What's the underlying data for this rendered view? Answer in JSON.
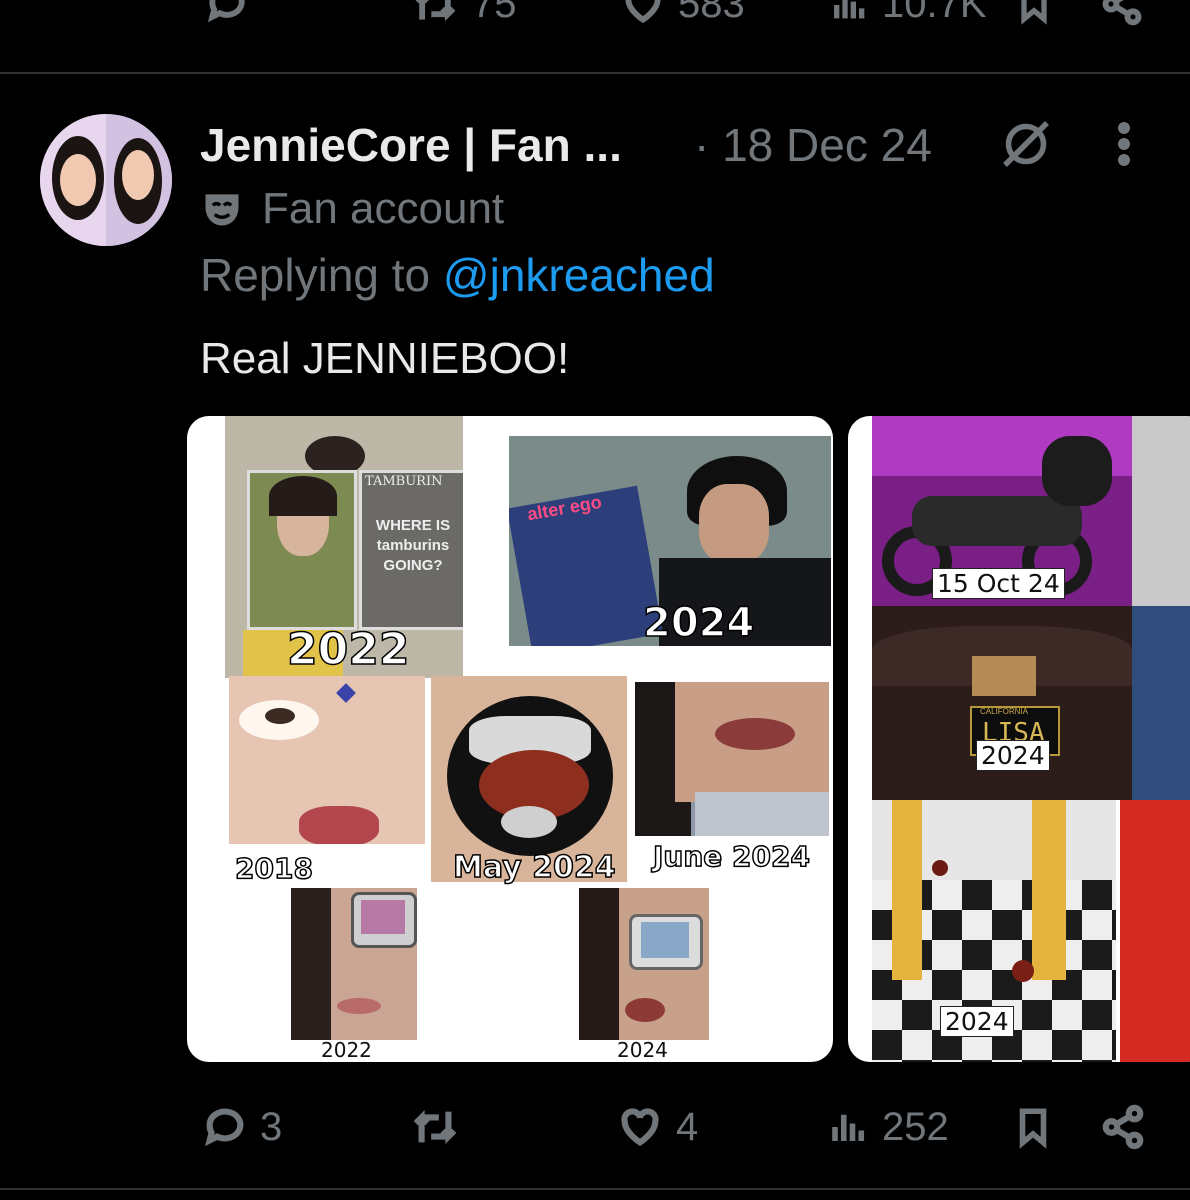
{
  "previous_post": {
    "retweets": "75",
    "likes": "583",
    "views": "10.7K"
  },
  "post": {
    "display_name": "JennieCore | Fan ...",
    "date": "· 18 Dec 24",
    "account_label": "Fan account",
    "reply_prefix": "Replying to",
    "reply_handle": "@jnkreached",
    "text": "Real JENNIEBOO!",
    "replies": "3",
    "retweets": "",
    "likes": "4",
    "views": "252"
  },
  "media_1": {
    "magazine_title": "TAMBURIN",
    "magazine_body": "WHERE IS tamburins GOING?",
    "magazine_cover_text": "alter ego",
    "captions": [
      "2022",
      "2024",
      "2018",
      "May 2024",
      "June 2024",
      "2022",
      "2024"
    ]
  },
  "media_2": {
    "plate_state": "CALIFORNIA",
    "plate_text": "LISA",
    "captions": [
      "15 Oct 24",
      "2024",
      "2024"
    ]
  },
  "icons": [
    "reply-icon",
    "retweet-icon",
    "like-icon",
    "views-icon",
    "bookmark-icon",
    "share-icon",
    "grok-icon",
    "more-icon",
    "mask-icon"
  ],
  "colors": {
    "background": "#000000",
    "text": "#e7e9ea",
    "muted": "#71767b",
    "link": "#1d9bf0",
    "divider": "#2f3336"
  }
}
